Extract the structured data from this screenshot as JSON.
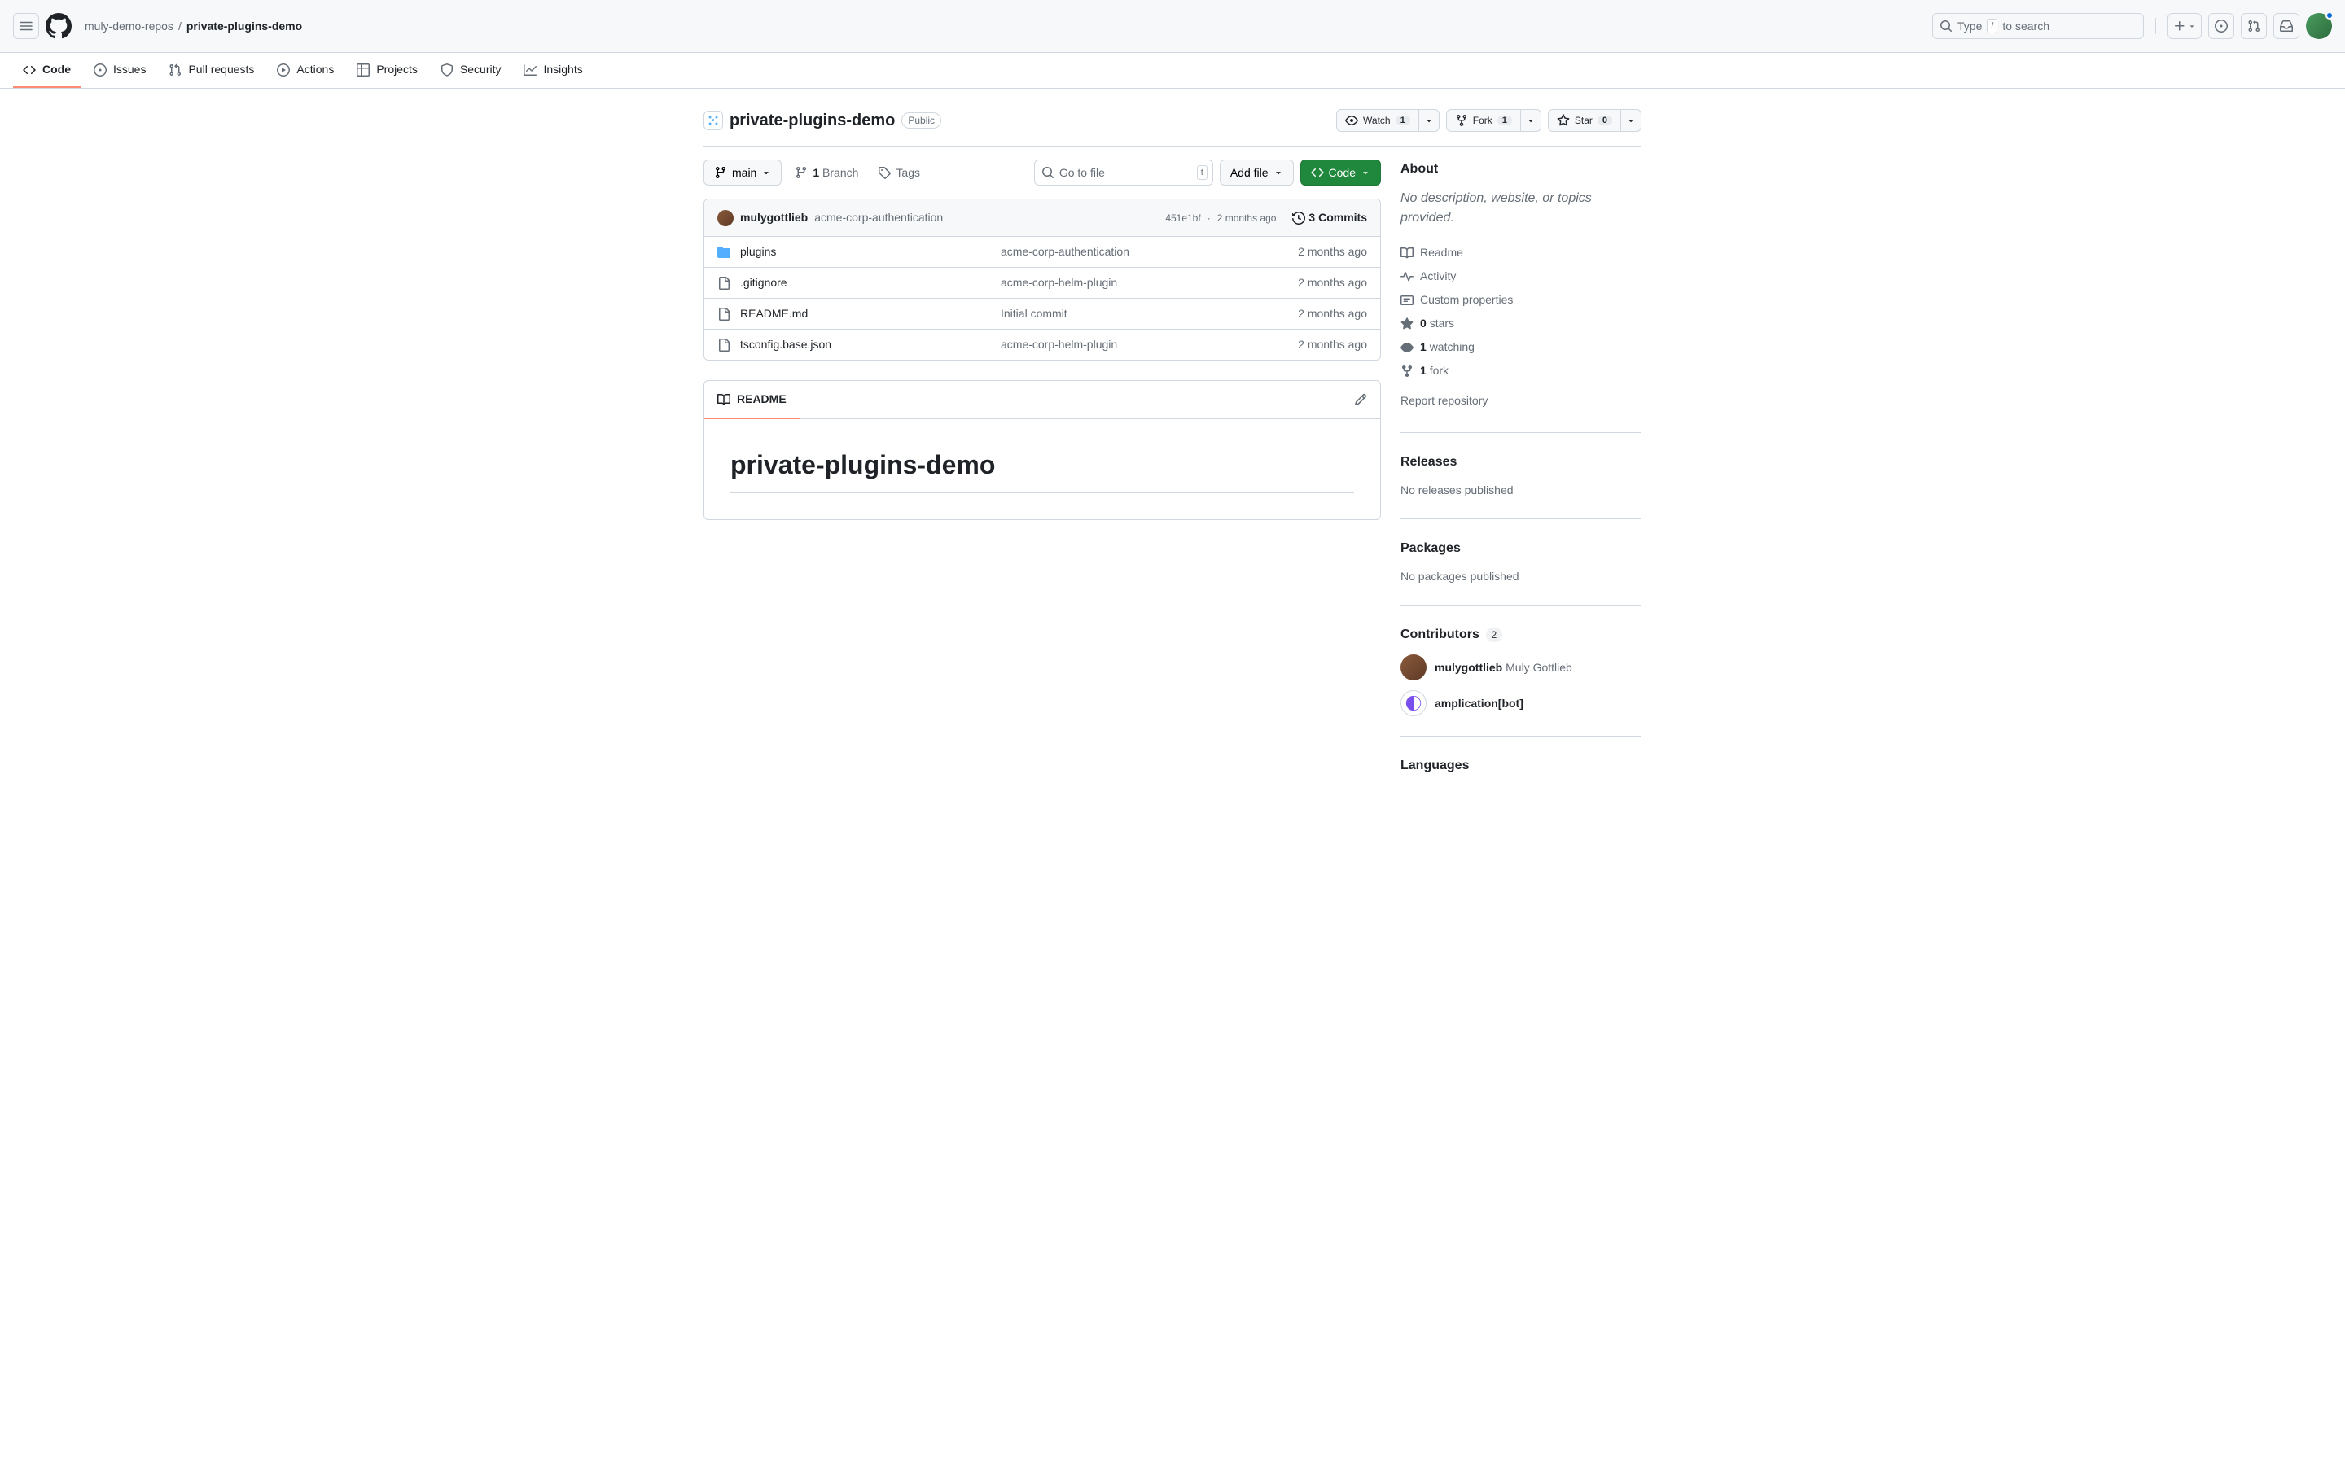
{
  "header": {
    "owner": "muly-demo-repos",
    "repo": "private-plugins-demo",
    "search_prefix": "Type",
    "search_slash": "/",
    "search_suffix": "to search"
  },
  "nav": {
    "code": "Code",
    "issues": "Issues",
    "pulls": "Pull requests",
    "actions": "Actions",
    "projects": "Projects",
    "security": "Security",
    "insights": "Insights"
  },
  "repo": {
    "name": "private-plugins-demo",
    "visibility": "Public",
    "watch_label": "Watch",
    "watch_count": "1",
    "fork_label": "Fork",
    "fork_count": "1",
    "star_label": "Star",
    "star_count": "0"
  },
  "filenav": {
    "branch": "main",
    "branch_count": "1",
    "branch_label": "Branch",
    "tags_label": "Tags",
    "gotofile": "Go to file",
    "gotofile_key": "t",
    "addfile": "Add file",
    "code": "Code"
  },
  "latest": {
    "author": "mulygottlieb",
    "message": "acme-corp-authentication",
    "sha": "451e1bf",
    "age": "2 months ago",
    "commits_count": "3 Commits"
  },
  "files": [
    {
      "type": "dir",
      "name": "plugins",
      "msg": "acme-corp-authentication",
      "age": "2 months ago"
    },
    {
      "type": "file",
      "name": ".gitignore",
      "msg": "acme-corp-helm-plugin",
      "age": "2 months ago"
    },
    {
      "type": "file",
      "name": "README.md",
      "msg": "Initial commit",
      "age": "2 months ago"
    },
    {
      "type": "file",
      "name": "tsconfig.base.json",
      "msg": "acme-corp-helm-plugin",
      "age": "2 months ago"
    }
  ],
  "readme": {
    "tab": "README",
    "heading": "private-plugins-demo"
  },
  "about": {
    "title": "About",
    "description": "No description, website, or topics provided.",
    "readme": "Readme",
    "activity": "Activity",
    "custom_props": "Custom properties",
    "stars_count": "0",
    "stars_label": "stars",
    "watching_count": "1",
    "watching_label": "watching",
    "forks_count": "1",
    "forks_label": "fork",
    "report": "Report repository"
  },
  "releases": {
    "title": "Releases",
    "text": "No releases published"
  },
  "packages": {
    "title": "Packages",
    "text": "No packages published"
  },
  "contributors": {
    "title": "Contributors",
    "count": "2",
    "items": [
      {
        "login": "mulygottlieb",
        "name": "Muly Gottlieb"
      },
      {
        "login": "amplication[bot]",
        "name": ""
      }
    ]
  },
  "languages": {
    "title": "Languages"
  }
}
